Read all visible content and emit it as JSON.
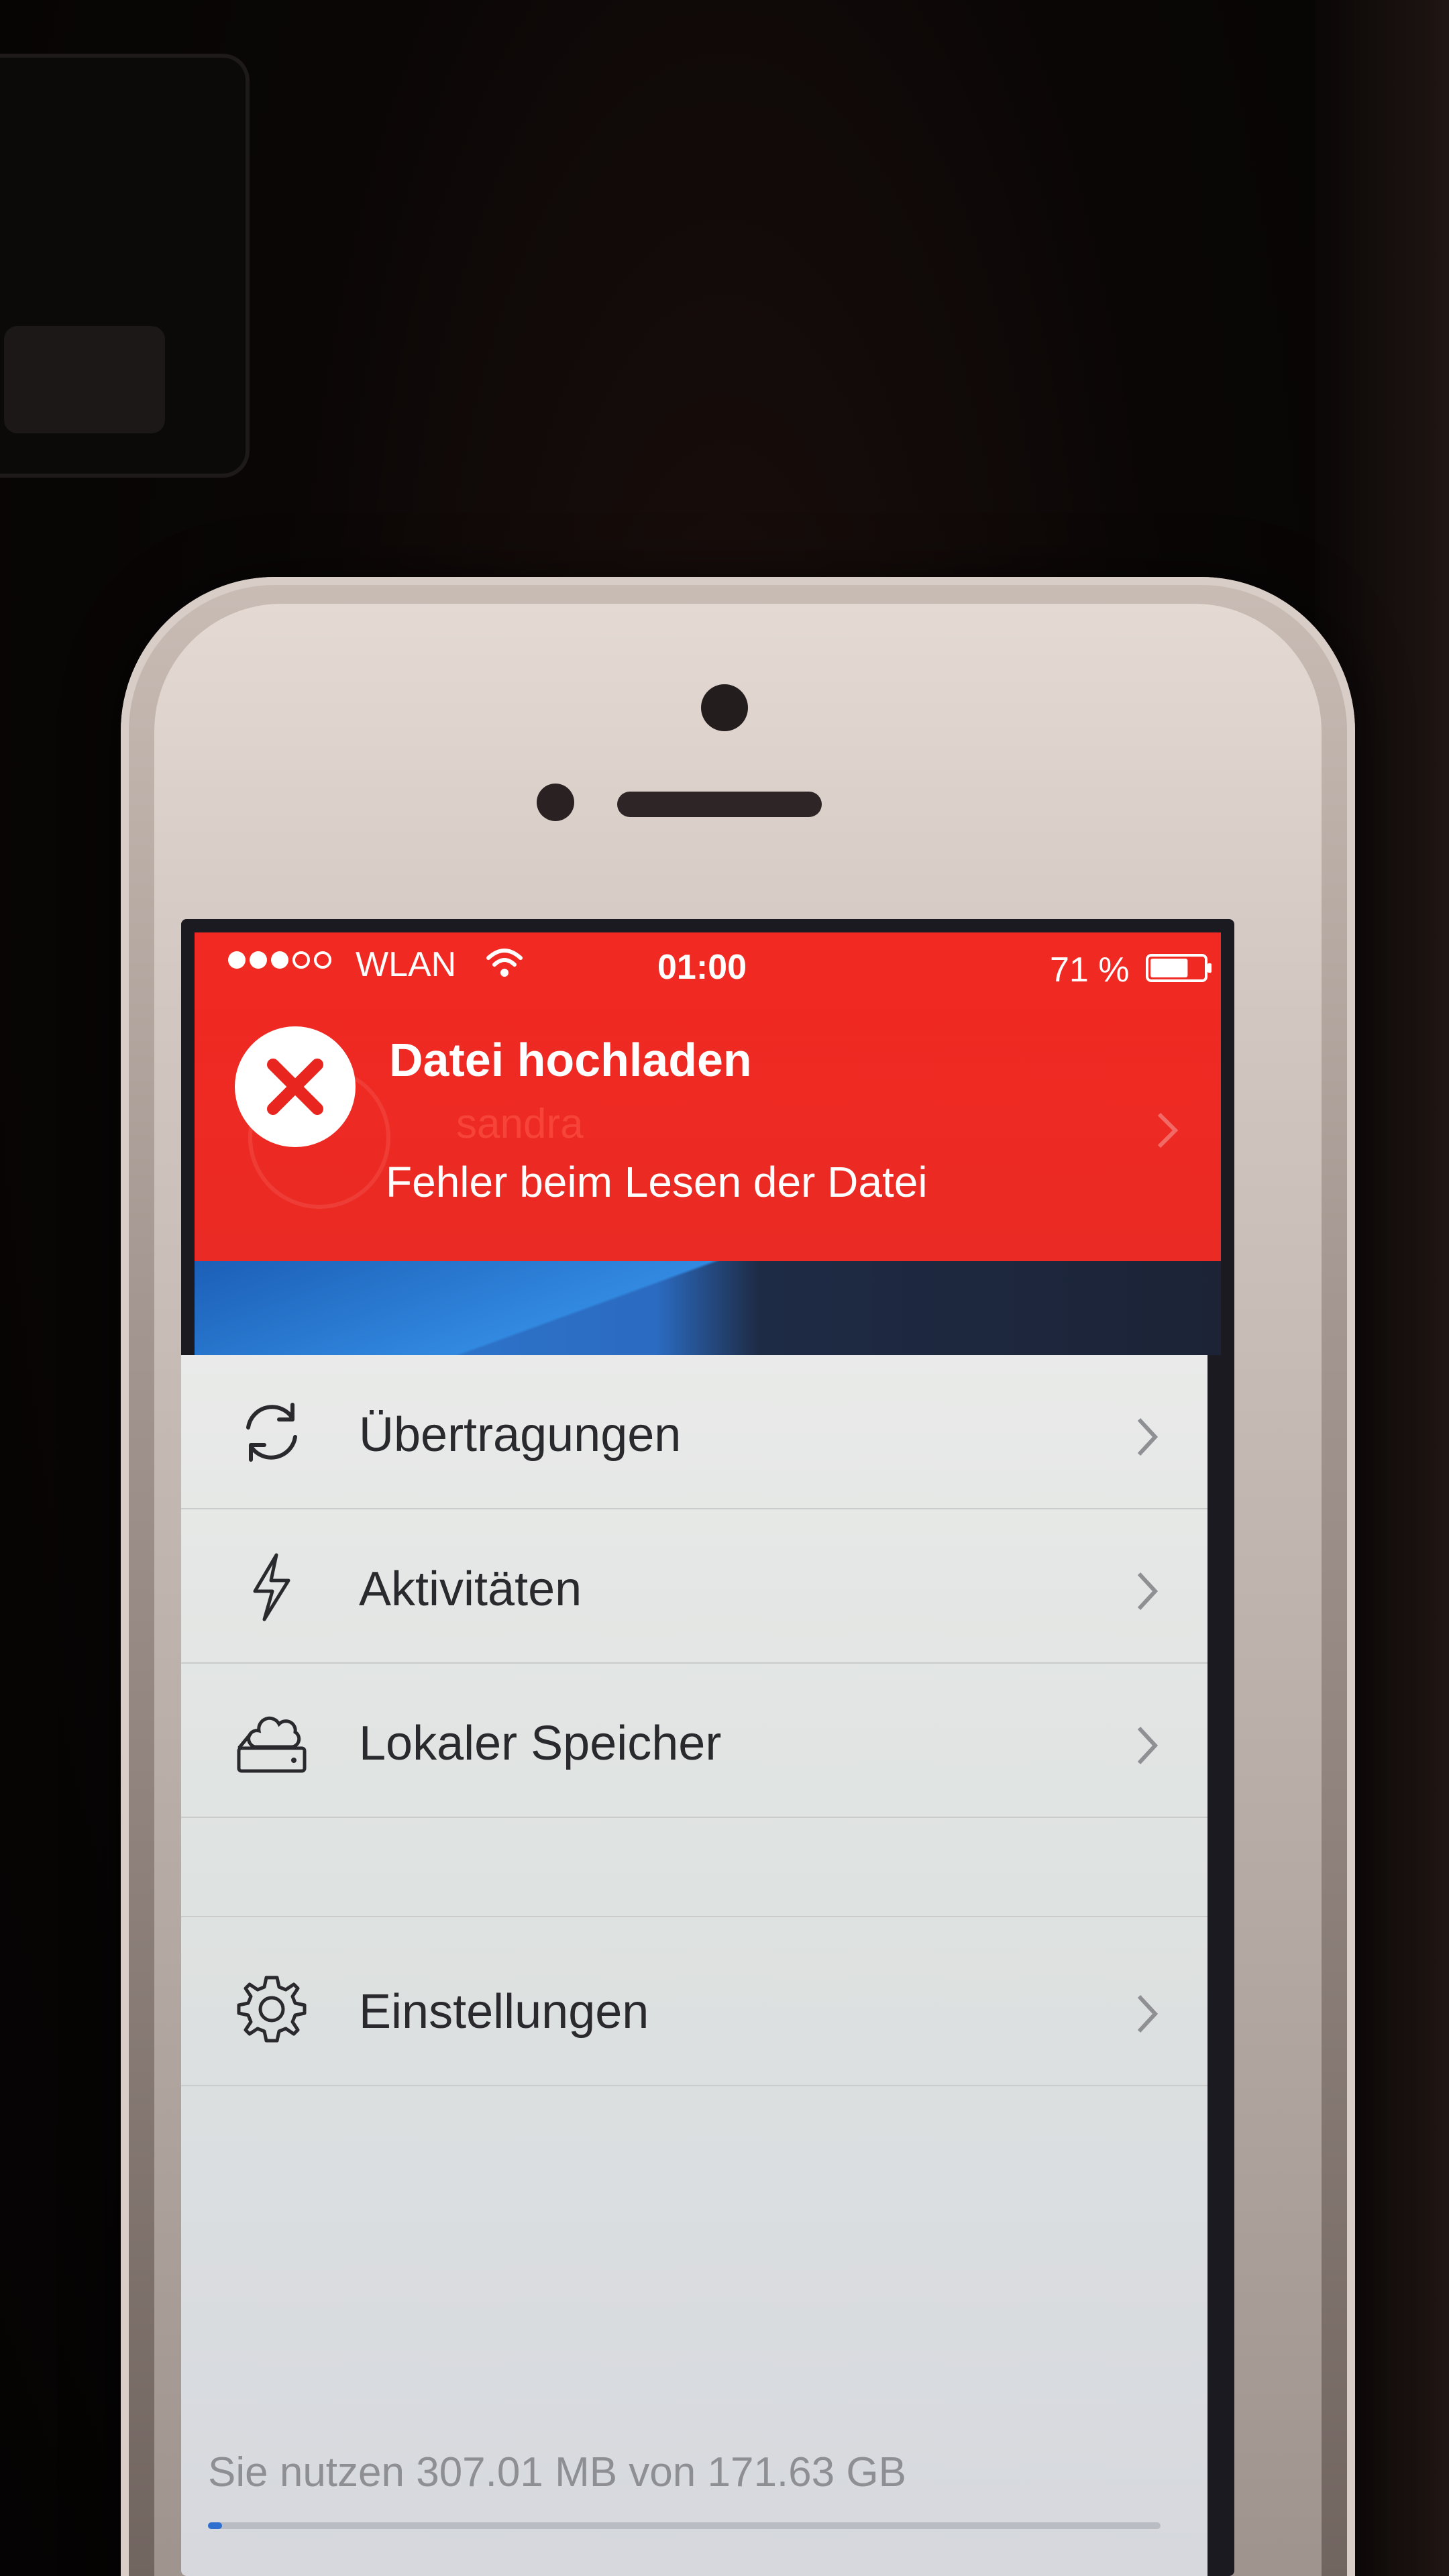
{
  "status_bar": {
    "carrier": "WLAN",
    "time": "01:00",
    "battery_percent": "71 %",
    "signal_strength": 3,
    "signal_max": 5,
    "battery_level": 0.71
  },
  "notification": {
    "title": "Datei hochladen",
    "message": "Fehler beim Lesen der Datei",
    "icon": "error-x-icon",
    "background_color": "#f12922"
  },
  "profile": {
    "name": "sandra"
  },
  "menu": {
    "items": [
      {
        "label": "Übertragungen",
        "icon": "sync-icon"
      },
      {
        "label": "Aktivitäten",
        "icon": "lightning-icon"
      },
      {
        "label": "Lokaler Speicher",
        "icon": "local-storage-icon"
      },
      {
        "label": "Einstellungen",
        "icon": "gear-icon"
      }
    ]
  },
  "storage": {
    "usage_text": "Sie nutzen 307.01 MB von 171.63 GB",
    "used_fraction": 0.0018
  }
}
